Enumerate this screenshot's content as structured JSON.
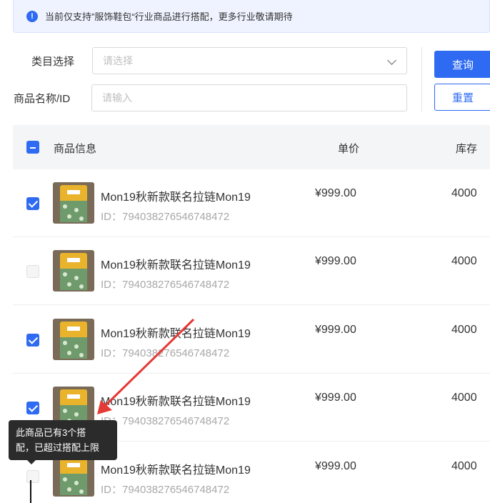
{
  "notice": {
    "icon": "info-icon",
    "text": "当前仅支持”服饰鞋包“行业商品进行搭配，更多行业敬请期待"
  },
  "form": {
    "category_label": "类目选择",
    "category_placeholder": "请选择",
    "name_label": "商品名称/ID",
    "name_placeholder": "请输入",
    "query_button": "查询",
    "reset_button": "重置"
  },
  "table": {
    "headers": {
      "product": "商品信息",
      "price": "单价",
      "stock": "库存"
    },
    "header_checkbox": "indeterminate",
    "rows": [
      {
        "checked": true,
        "name": "Mon19秋新款联名拉链Mon19",
        "id": "ID：794038276546748472",
        "price": "¥999.00",
        "stock": "4000"
      },
      {
        "checked": false,
        "name": "Mon19秋新款联名拉链Mon19",
        "id": "ID：794038276546748472",
        "price": "¥999.00",
        "stock": "4000"
      },
      {
        "checked": true,
        "name": "Mon19秋新款联名拉链Mon19",
        "id": "ID：794038276546748472",
        "price": "¥999.00",
        "stock": "4000"
      },
      {
        "checked": true,
        "name": "Mon19秋新款联名拉链Mon19",
        "id": "ID：794038276546748472",
        "price": "¥999.00",
        "stock": "4000"
      },
      {
        "checked": false,
        "name": "Mon19秋新款联名拉链Mon19",
        "id": "ID：794038276546748472",
        "price": "¥999.00",
        "stock": "4000"
      }
    ]
  },
  "tooltip": {
    "line1": "此商品已有3个搭",
    "line2": "配，已超过搭配上限"
  },
  "colors": {
    "primary": "#2f6bf2",
    "annotation_arrow": "#e53935",
    "tooltip_bg": "#2b2b2b"
  }
}
